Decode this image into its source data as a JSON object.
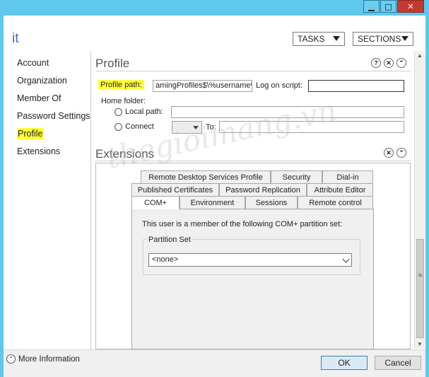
{
  "window": {
    "min_glyph": "▁",
    "max_glyph": "□",
    "close_glyph": "✕"
  },
  "header": {
    "title": "it",
    "tasks_label": "TASKS",
    "sections_label": "SECTIONS"
  },
  "nav": {
    "items": [
      {
        "label": "Account"
      },
      {
        "label": "Organization"
      },
      {
        "label": "Member Of"
      },
      {
        "label": "Password Settings"
      },
      {
        "label": "Profile"
      },
      {
        "label": "Extensions"
      }
    ],
    "selected": "Profile"
  },
  "profile": {
    "title": "Profile",
    "help_glyph": "?",
    "close_glyph": "✕",
    "collapse_glyph": "⌃",
    "profile_path_label": "Profile path:",
    "profile_path_value": "amingProfiles$\\%username%",
    "logon_script_label": "Log on script:",
    "logon_script_value": "",
    "home_folder_label": "Home folder:",
    "local_path_label": "Local path:",
    "connect_label": "Connect",
    "to_label": "To:"
  },
  "extensions": {
    "title": "Extensions",
    "tabs_row1": [
      "Remote Desktop Services Profile",
      "Security",
      "Dial-in"
    ],
    "tabs_row2": [
      "Published Certificates",
      "Password Replication",
      "Attribute Editor"
    ],
    "tabs_row3": [
      "COM+",
      "Environment",
      "Sessions",
      "Remote control"
    ],
    "active_tab": "COM+",
    "member_text": "This user is a member of the following COM+ partition set:",
    "partition_label": "Partition Set",
    "partition_value": "<none>"
  },
  "watermark": "thegioimang.vn",
  "footer": {
    "more_info_label": "More Information",
    "ok_label": "OK",
    "cancel_label": "Cancel"
  },
  "colors": {
    "titlebar": "#5fc8ec",
    "highlight": "#ffff38",
    "close_red": "#c7382e"
  }
}
